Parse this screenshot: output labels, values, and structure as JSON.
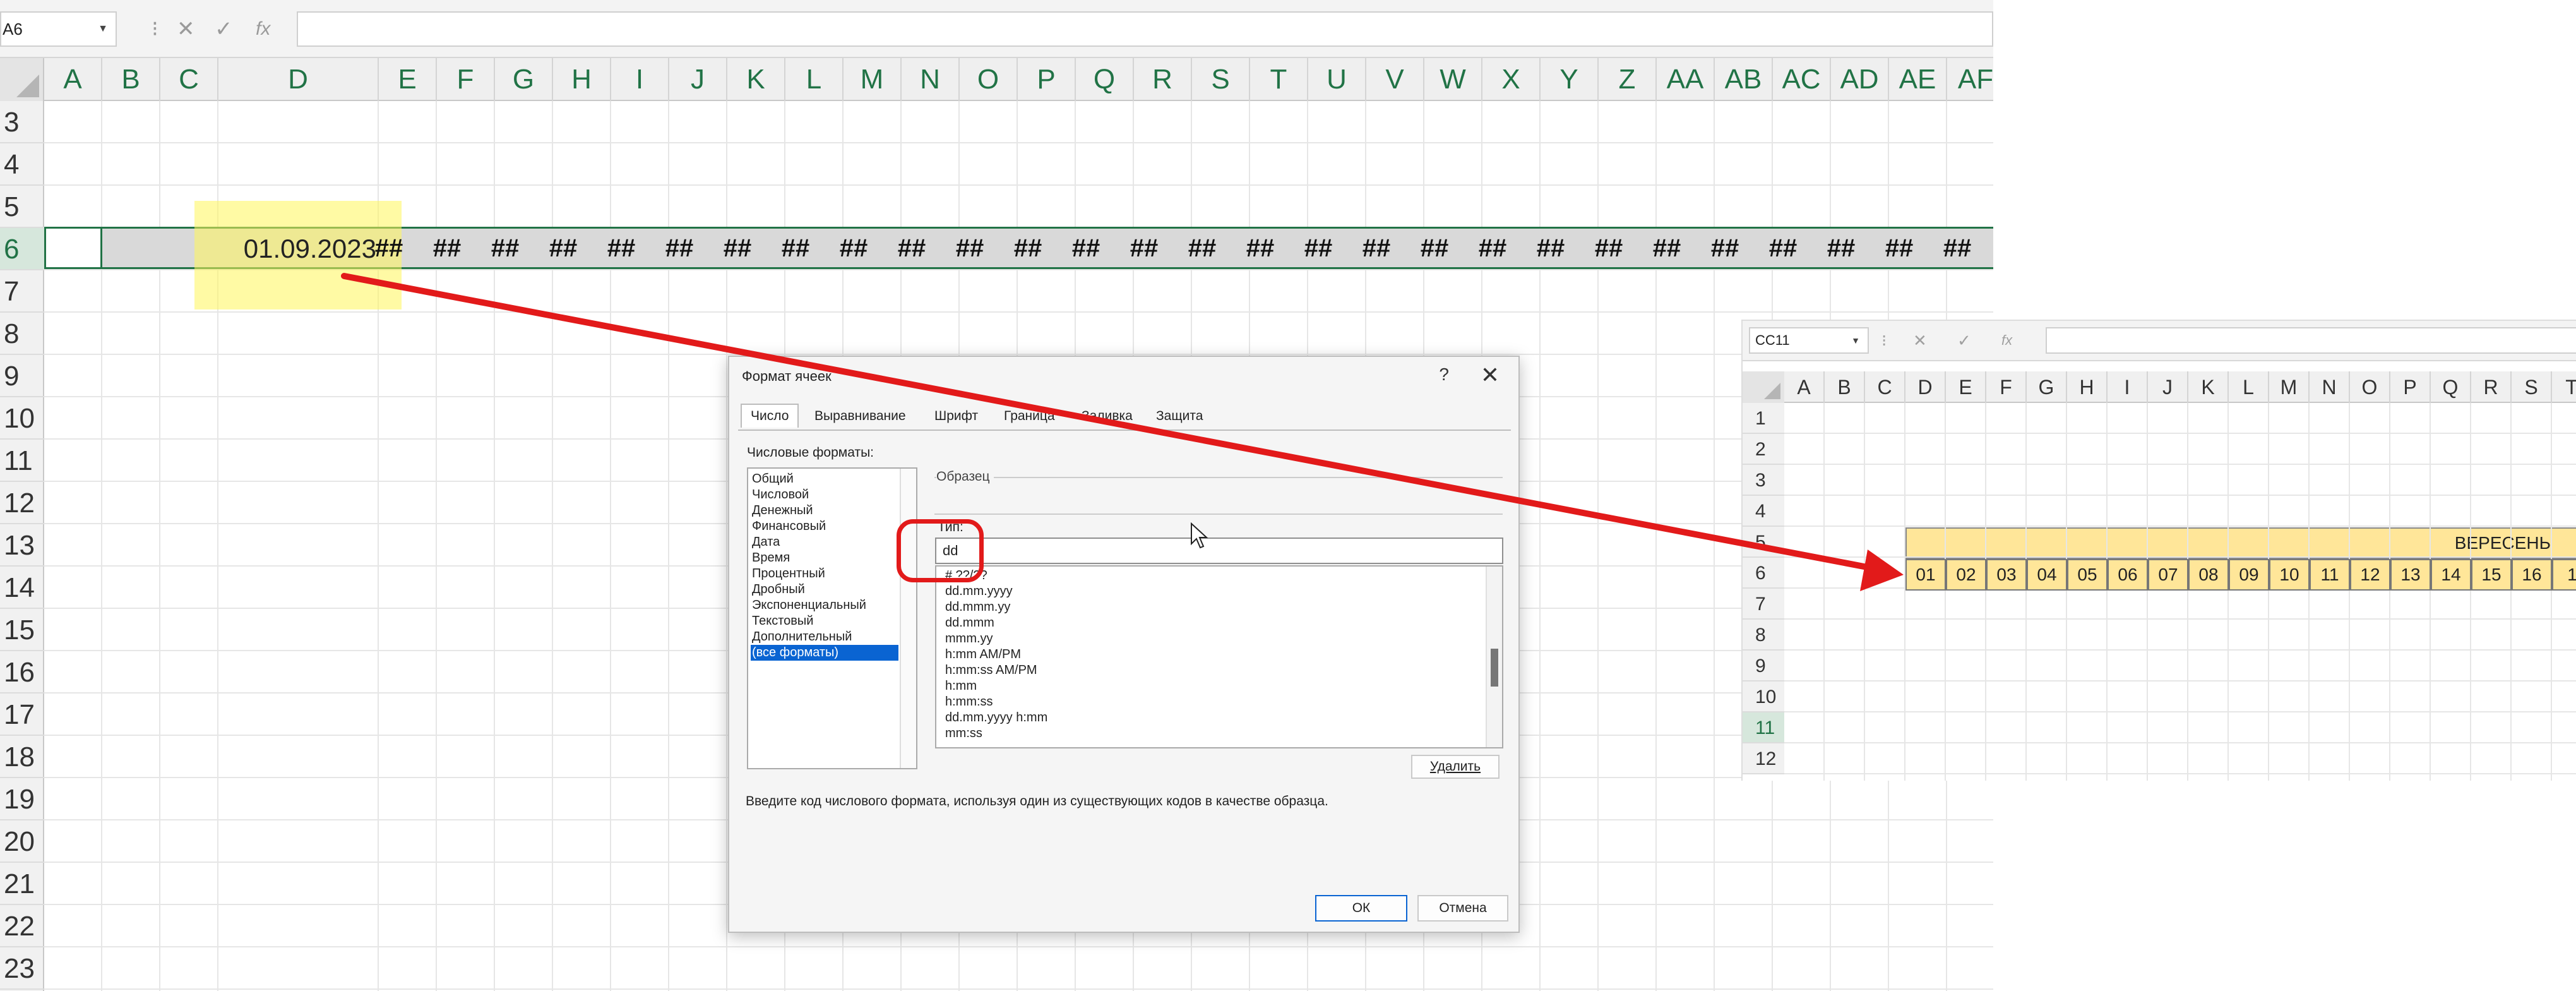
{
  "main_sheet": {
    "name_box": "A6",
    "formula_icons": [
      "⁝",
      "✕",
      "✓",
      "fx"
    ],
    "formula_value": "",
    "columns": [
      "A",
      "B",
      "C",
      "D",
      "E",
      "F",
      "G",
      "H",
      "I",
      "J",
      "K",
      "L",
      "M",
      "N",
      "O",
      "P",
      "Q",
      "R",
      "S",
      "T",
      "U",
      "V",
      "W",
      "X",
      "Y",
      "Z",
      "AA",
      "AB",
      "AC",
      "AD",
      "AE",
      "AF"
    ],
    "rows": [
      "3",
      "4",
      "5",
      "6",
      "7",
      "8",
      "9",
      "10",
      "11",
      "12",
      "13",
      "14",
      "15",
      "16",
      "17",
      "18",
      "19",
      "20",
      "21",
      "22",
      "23"
    ],
    "selected_row": "6",
    "date_cell": "01.09.2023",
    "overflow_text": "##"
  },
  "dialog": {
    "title": "Формат ячеек",
    "help": "?",
    "close": "✕",
    "tabs": [
      "Число",
      "Выравнивание",
      "Шрифт",
      "Граница",
      "Заливка",
      "Защита"
    ],
    "active_tab": "Число",
    "categories_label": "Числовые форматы:",
    "categories": [
      "Общий",
      "Числовой",
      "Денежный",
      "Финансовый",
      "Дата",
      "Время",
      "Процентный",
      "Дробный",
      "Экспоненциальный",
      "Текстовый",
      "Дополнительный",
      "(все форматы)"
    ],
    "selected_category": "(все форматы)",
    "sample_label": "Образец",
    "type_label": "Тип:",
    "type_value": "dd",
    "format_codes": [
      "# ??/??",
      "dd.mm.yyyy",
      "dd.mmm.yy",
      "dd.mmm",
      "mmm.yy",
      "h:mm AM/PM",
      "h:mm:ss AM/PM",
      "h:mm",
      "h:mm:ss",
      "dd.mm.yyyy h:mm",
      "mm:ss"
    ],
    "delete_button": "Удалить",
    "hint": "Введите код числового формата, используя один из существующих кодов в качестве образца.",
    "ok_button": "ОК",
    "cancel_button": "Отмена"
  },
  "inset_sheet": {
    "name_box": "CC11",
    "formula_icons": [
      "⁝",
      "✕",
      "✓",
      "fx"
    ],
    "columns": [
      "A",
      "B",
      "C",
      "D",
      "E",
      "F",
      "G",
      "H",
      "I",
      "J",
      "K",
      "L",
      "M",
      "N",
      "O",
      "P",
      "Q",
      "R",
      "S",
      "T"
    ],
    "rows": [
      "1",
      "2",
      "3",
      "4",
      "5",
      "6",
      "7",
      "8",
      "9",
      "10",
      "11",
      "12"
    ],
    "selected_row": "11",
    "banner": "ВЕРЕСЕНЬ",
    "days": [
      "01",
      "02",
      "03",
      "04",
      "05",
      "06",
      "07",
      "08",
      "09",
      "10",
      "11",
      "12",
      "13",
      "14",
      "15",
      "16",
      "1"
    ]
  },
  "colors": {
    "excel_green": "#217346",
    "highlight_yellow": "#fff55a",
    "banner_yellow": "#ffe699",
    "annotation_red": "#e21a1a",
    "selection_blue": "#0a64d2"
  }
}
